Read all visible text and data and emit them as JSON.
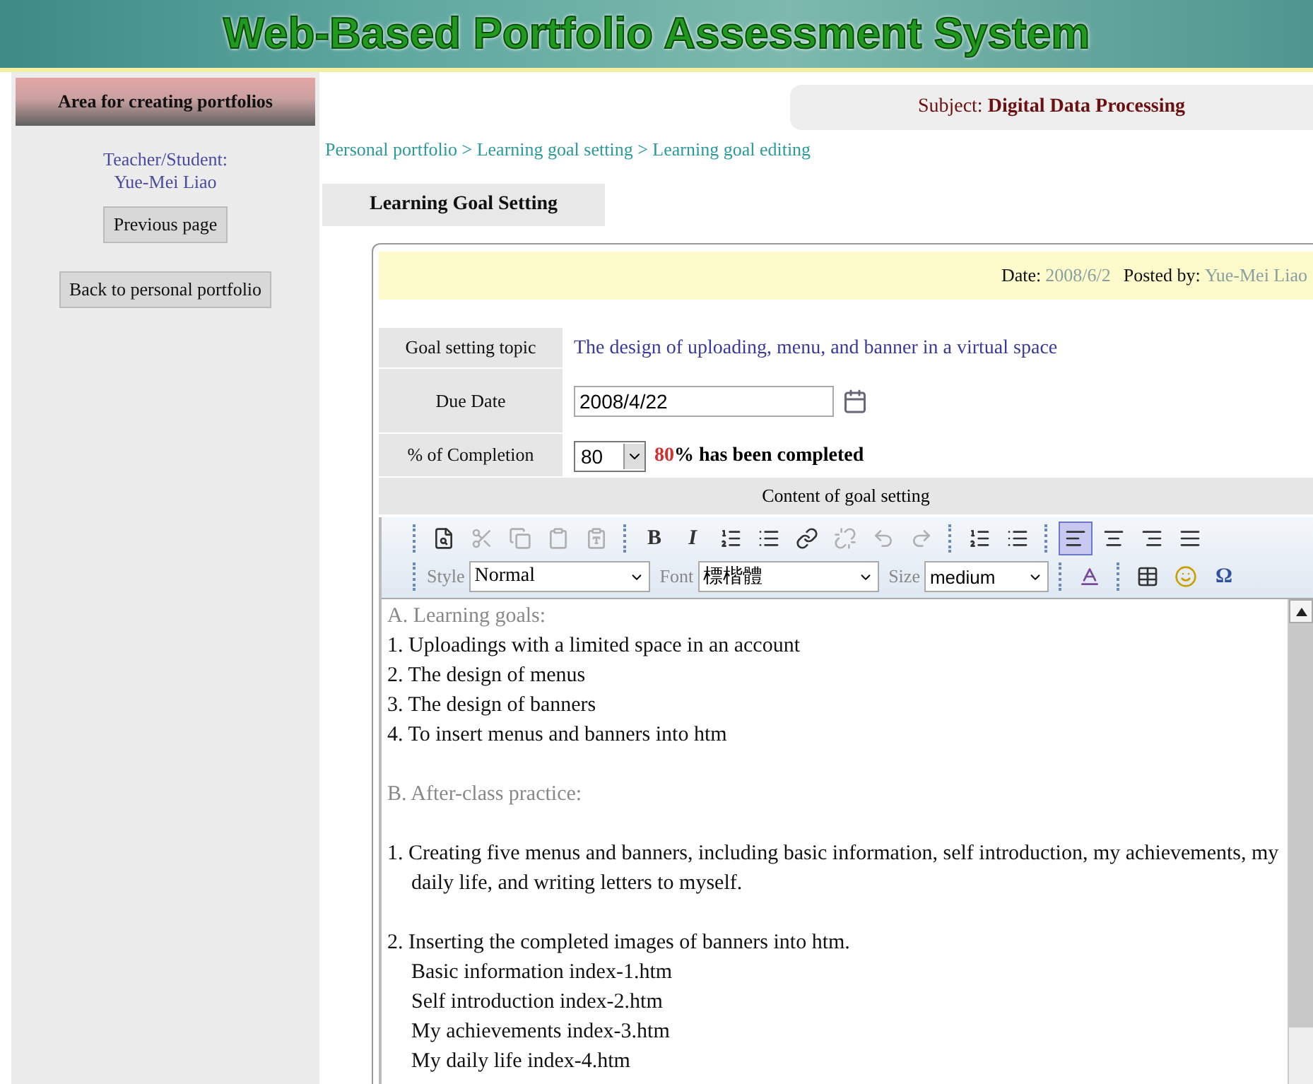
{
  "header": {
    "title": "Web-Based Portfolio Assessment System"
  },
  "sidebar": {
    "heading": "Area for creating portfolios",
    "user_label": "Teacher/Student:",
    "user_name": "Yue-Mei Liao",
    "buttons": [
      "Previous page",
      "Back to personal portfolio"
    ]
  },
  "subject": {
    "label": "Subject:",
    "value": "Digital Data Processing"
  },
  "breadcrumb": "Personal portfolio > Learning goal setting > Learning goal editing",
  "tabs": [
    {
      "label": "Learning Goal Setting",
      "selected": true
    }
  ],
  "post_info": {
    "date_label": "Date:",
    "date": "2008/6/2",
    "posted_label": "Posted by:",
    "poster": "Yue-Mei Liao"
  },
  "form": {
    "topic_label": "Goal setting topic",
    "topic": "The design of uploading, menu, and banner in a virtual space",
    "due_label": "Due Date",
    "due_date": "2008/4/22",
    "completion_label": "% of Completion",
    "completion_value": "80",
    "completion_percent": "80",
    "completion_text": "% has been completed",
    "content_label": "Content of goal setting"
  },
  "toolbar": {
    "row_1": [
      {
        "kind": "preview",
        "disabled": false,
        "selected": false
      },
      {
        "kind": "cut",
        "disabled": true,
        "selected": false
      },
      {
        "kind": "copy",
        "disabled": true,
        "selected": false
      },
      {
        "kind": "paste",
        "disabled": true,
        "selected": false
      },
      {
        "kind": "paste-word",
        "disabled": true,
        "selected": false,
        "group_end": true
      },
      {
        "kind": "bold",
        "text": "B",
        "disabled": false,
        "selected": false
      },
      {
        "kind": "italic",
        "text": "I",
        "disabled": false,
        "selected": false
      },
      {
        "kind": "ordered-list",
        "disabled": false,
        "selected": false
      },
      {
        "kind": "bullet-list",
        "disabled": false,
        "selected": false
      },
      {
        "kind": "link",
        "disabled": false,
        "selected": false
      },
      {
        "kind": "unlink",
        "disabled": true,
        "selected": false
      },
      {
        "kind": "undo",
        "disabled": true,
        "selected": false
      },
      {
        "kind": "redo",
        "disabled": true,
        "selected": false,
        "group_end": true
      },
      {
        "kind": "ordered-list",
        "disabled": false,
        "selected": false
      },
      {
        "kind": "bullet-list",
        "disabled": false,
        "selected": false,
        "group_end": true
      },
      {
        "kind": "align-left",
        "disabled": false,
        "selected": true
      },
      {
        "kind": "align-center",
        "disabled": false,
        "selected": false
      },
      {
        "kind": "align-right",
        "disabled": false,
        "selected": false
      },
      {
        "kind": "align-justify",
        "disabled": false,
        "selected": false
      }
    ],
    "style_label": "Style",
    "style_value": "Normal",
    "font_label": "Font",
    "font_value": "標楷體",
    "size_label": "Size",
    "size_value": "medium",
    "special_char": "Ω"
  },
  "content": [
    {
      "kind": "heading",
      "text": "A. Learning goals:"
    },
    {
      "kind": "item",
      "text": "1. Uploadings with a limited space in an account"
    },
    {
      "kind": "item",
      "text": "2. The design of menus"
    },
    {
      "kind": "item",
      "text": "3. The design of banners"
    },
    {
      "kind": "item",
      "text": "4. To insert menus and banners into htm"
    },
    {
      "kind": "heading",
      "text": "B. After-class practice:",
      "gap_before": true
    },
    {
      "kind": "item",
      "text": "1. Creating five menus and banners, including basic information, self introduction, my achievements, my daily life, and writing letters to myself.",
      "gap_before": true
    },
    {
      "kind": "item",
      "text": "2. Inserting the completed images of banners into htm.",
      "gap_before": true
    },
    {
      "kind": "subitem",
      "text": "Basic information index-1.htm"
    },
    {
      "kind": "subitem",
      "text": "Self introduction index-2.htm"
    },
    {
      "kind": "subitem",
      "text": "My achievements index-3.htm"
    },
    {
      "kind": "subitem",
      "text": "My daily life index-4.htm"
    }
  ]
}
